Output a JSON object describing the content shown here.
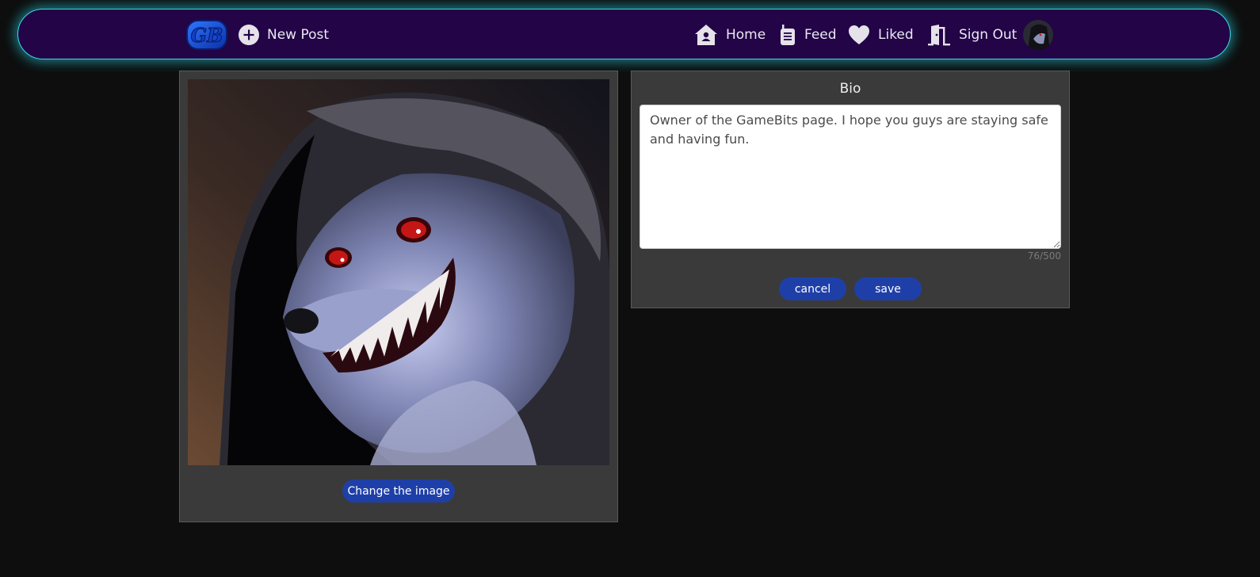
{
  "nav": {
    "logo_text": "GB",
    "new_post_label": "New Post",
    "home_label": "Home",
    "feed_label": "Feed",
    "liked_label": "Liked",
    "sign_out_label": "Sign Out",
    "icons": {
      "new_post": "plus-circle-icon",
      "home": "home-icon",
      "feed": "walkie-talkie-icon",
      "liked": "heart-icon",
      "sign_out": "door-open-icon"
    },
    "colors": {
      "bar_background": "#220447",
      "glow": "#3fd6e0"
    }
  },
  "image_panel": {
    "change_image_label": "Change the image"
  },
  "bio_panel": {
    "title": "Bio",
    "text": "Owner of the GameBits page. I hope you guys are staying safe and having fun.",
    "char_count": "76/500",
    "cancel_label": "cancel",
    "save_label": "save"
  },
  "colors": {
    "page_background": "#0e0e0e",
    "panel_background": "#3a3a3a",
    "button": "#1f3fa8"
  }
}
